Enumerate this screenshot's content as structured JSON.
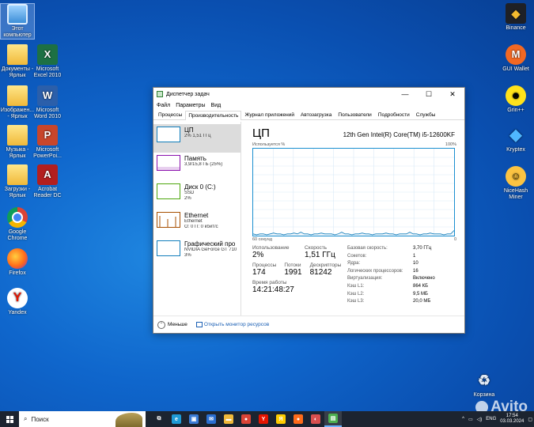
{
  "desktop": {
    "left_icons": [
      {
        "label": "Этот компьютер",
        "icon": "pc-icon",
        "glyph": "",
        "cls": "pc"
      },
      {
        "label": "Документы - Ярлык",
        "icon": "folder-icon",
        "glyph": "",
        "cls": "folder"
      },
      {
        "label": "Microsoft Excel 2010",
        "icon": "excel-icon",
        "glyph": "X",
        "cls": "excel"
      },
      {
        "label": "Изображен... - Ярлык",
        "icon": "folder-icon",
        "glyph": "",
        "cls": "folder"
      },
      {
        "label": "Microsoft Word 2010",
        "icon": "word-icon",
        "glyph": "W",
        "cls": "word"
      },
      {
        "label": "Музыка - Ярлык",
        "icon": "folder-icon",
        "glyph": "",
        "cls": "folder"
      },
      {
        "label": "Microsoft PowerPoi...",
        "icon": "powerpoint-icon",
        "glyph": "P",
        "cls": "ppt"
      },
      {
        "label": "Загрузки - Ярлык",
        "icon": "folder-icon",
        "glyph": "",
        "cls": "folder"
      },
      {
        "label": "Acrobat Reader DC",
        "icon": "acrobat-icon",
        "glyph": "A",
        "cls": "pdf"
      },
      {
        "label": "Google Chrome",
        "icon": "chrome-icon",
        "glyph": "",
        "cls": "chrome"
      },
      {
        "label": "Firefox",
        "icon": "firefox-icon",
        "glyph": "",
        "cls": "firefox"
      },
      {
        "label": "Yandex",
        "icon": "yandex-icon",
        "glyph": "Y",
        "cls": "yandex"
      }
    ],
    "right_icons": [
      {
        "label": "Binance",
        "icon": "binance-icon",
        "glyph": "◆",
        "cls": "binance"
      },
      {
        "label": "GUI Wallet",
        "icon": "monero-icon",
        "glyph": "M",
        "cls": "gui"
      },
      {
        "label": "Grin++",
        "icon": "grin-icon",
        "glyph": "☻",
        "cls": "grin"
      },
      {
        "label": "Kryptex",
        "icon": "kryptex-icon",
        "glyph": "◆",
        "cls": "kryptex"
      },
      {
        "label": "NiceHash Miner",
        "icon": "nicehash-icon",
        "glyph": "☺",
        "cls": "nicehash"
      },
      {
        "label": "Корзина",
        "icon": "recycle-bin-icon",
        "glyph": "♻",
        "cls": "bin"
      }
    ]
  },
  "window": {
    "title": "Диспетчер задач",
    "menu": [
      "Файл",
      "Параметры",
      "Вид"
    ],
    "tabs": [
      "Процессы",
      "Производительность",
      "Журнал приложений",
      "Автозагрузка",
      "Пользователи",
      "Подробности",
      "Службы"
    ],
    "active_tab": 1,
    "sidebar": [
      {
        "name": "ЦП",
        "sub1": "2% 1,51 ГГц",
        "sub2": "",
        "color": "#117dbb"
      },
      {
        "name": "Память",
        "sub1": "3,9/15,8 ГБ (25%)",
        "sub2": "",
        "color": "#8b12ae"
      },
      {
        "name": "Диск 0 (C:)",
        "sub1": "SSD",
        "sub2": "2%",
        "color": "#4da60c"
      },
      {
        "name": "Ethernet",
        "sub1": "Ethernet",
        "sub2": "О: 0 П: 0 кбит/с",
        "color": "#a74f01"
      },
      {
        "name": "Графический про",
        "sub1": "NVIDIA GeForce GT 710",
        "sub2": "3%",
        "color": "#117dbb"
      }
    ],
    "main": {
      "title": "ЦП",
      "cpu_name": "12th Gen Intel(R) Core(TM) i5-12600KF",
      "axis_top_left": "Используется %",
      "axis_top_right": "100%",
      "axis_bottom_left": "60 секунд",
      "axis_bottom_right": "0",
      "usage_label": "Использование",
      "usage_value": "2%",
      "speed_label": "Скорость",
      "speed_value": "1,51 ГГц",
      "processes_label": "Процессы",
      "processes_value": "174",
      "threads_label": "Потоки",
      "threads_value": "1991",
      "handles_label": "Дескрипторы",
      "handles_value": "81242",
      "uptime_label": "Время работы",
      "uptime_value": "14:21:48:27",
      "specs": [
        {
          "k": "Базовая скорость:",
          "v": "3,70 ГГц"
        },
        {
          "k": "Сокетов:",
          "v": "1"
        },
        {
          "k": "Ядра:",
          "v": "10"
        },
        {
          "k": "Логических процессоров:",
          "v": "16"
        },
        {
          "k": "Виртуализация:",
          "v": "Включено"
        },
        {
          "k": "Кэш L1:",
          "v": "864 КБ"
        },
        {
          "k": "Кэш L2:",
          "v": "9,5 МБ"
        },
        {
          "k": "Кэш L3:",
          "v": "20,0 МБ"
        }
      ]
    },
    "footer": {
      "less": "Меньше",
      "monitor": "Открыть монитор ресурсов"
    }
  },
  "cpu_graph": {
    "type": "line",
    "ylim": [
      0,
      100
    ],
    "values": [
      2,
      1,
      2,
      2,
      1,
      2,
      3,
      2,
      2,
      1,
      2,
      2,
      3,
      2,
      4,
      2,
      2,
      1,
      2,
      2,
      3,
      2,
      2,
      2,
      1,
      2,
      4,
      2,
      2,
      1,
      2,
      2,
      3,
      2,
      2,
      1,
      2,
      2,
      2,
      3,
      2,
      2,
      1,
      2,
      2,
      2,
      4,
      2,
      2,
      1,
      2,
      2,
      3,
      2,
      2,
      2,
      1,
      2,
      2,
      6
    ]
  },
  "taskbar": {
    "search_placeholder": "Поиск",
    "apps": [
      {
        "icon": "task-view-icon",
        "glyph": "⧉",
        "bg": "transparent"
      },
      {
        "icon": "edge-icon",
        "glyph": "e",
        "bg": "#1f9bd6"
      },
      {
        "icon": "store-icon",
        "glyph": "▣",
        "bg": "#3a7bd5"
      },
      {
        "icon": "mail-icon",
        "glyph": "✉",
        "bg": "#2b6fd1"
      },
      {
        "icon": "explorer-icon",
        "glyph": "▬",
        "bg": "#f0b93a"
      },
      {
        "icon": "chrome-icon",
        "glyph": "●",
        "bg": "#db4437"
      },
      {
        "icon": "yandex-browser-icon",
        "glyph": "Y",
        "bg": "#e61400"
      },
      {
        "icon": "yandex-icon",
        "glyph": "Я",
        "bg": "#ffcc00"
      },
      {
        "icon": "firefox-icon",
        "glyph": "●",
        "bg": "#ff6b1a"
      },
      {
        "icon": "tool-icon",
        "glyph": "◐",
        "bg": "#d94f4f"
      },
      {
        "icon": "task-manager-icon",
        "glyph": "▤",
        "bg": "#4caf50"
      }
    ],
    "lang": "ENG",
    "time": "17:54",
    "date": "03.03.2024"
  },
  "watermark": "Avito"
}
